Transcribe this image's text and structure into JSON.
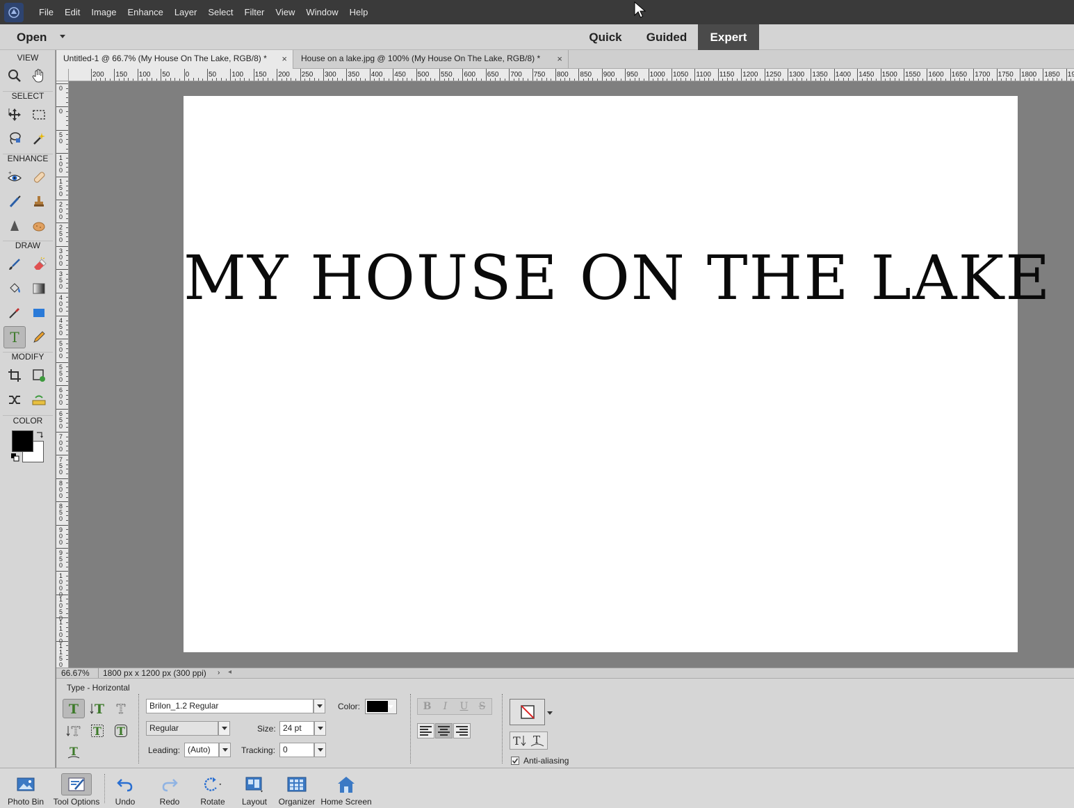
{
  "menubar": {
    "logo_icon": "elements-logo-icon",
    "items": [
      "File",
      "Edit",
      "Image",
      "Enhance",
      "Layer",
      "Select",
      "Filter",
      "View",
      "Window",
      "Help"
    ]
  },
  "modebar": {
    "open_label": "Open",
    "tabs": {
      "quick": "Quick",
      "guided": "Guided",
      "expert": "Expert"
    },
    "active_tab": "Expert"
  },
  "toolbox": {
    "sections": {
      "view": "VIEW",
      "select": "SELECT",
      "enhance": "ENHANCE",
      "draw": "DRAW",
      "modify": "MODIFY",
      "color": "COLOR"
    },
    "tools": {
      "view": [
        "zoom-tool-icon",
        "hand-tool-icon"
      ],
      "select": [
        "move-tool-icon",
        "marquee-tool-icon",
        "lasso-tool-icon",
        "magic-wand-icon"
      ],
      "enhance": [
        "red-eye-icon",
        "spot-healing-icon",
        "smart-brush-icon",
        "clone-stamp-icon",
        "blur-icon",
        "sponge-icon"
      ],
      "draw": [
        "brush-icon",
        "eraser-icon",
        "paint-bucket-icon",
        "gradient-icon",
        "eyedropper-icon",
        "rectangle-shape-icon",
        "type-tool-icon",
        "pencil-icon"
      ],
      "modify": [
        "crop-icon",
        "recompose-icon",
        "content-aware-move-icon",
        "straighten-icon"
      ]
    },
    "active_tool": "type-tool-icon",
    "foreground_color": "#000000",
    "background_color": "#ffffff"
  },
  "documents": {
    "tabs": [
      {
        "label": "Untitled-1 @ 66.7% (My House On The Lake, RGB/8) *",
        "close": "×",
        "active": true
      },
      {
        "label": "House on a lake.jpg @ 100% (My House On The Lake, RGB/8) *",
        "close": "×",
        "active": false
      }
    ]
  },
  "rulers": {
    "horizontal": [
      "200",
      "150",
      "100",
      "50",
      "0",
      "50",
      "100",
      "150",
      "200",
      "250",
      "300",
      "350",
      "400",
      "450",
      "500",
      "550",
      "600",
      "650",
      "700",
      "750",
      "800",
      "850",
      "900",
      "950",
      "1000",
      "1050",
      "1100",
      "1150",
      "1200",
      "1250",
      "1300",
      "1350",
      "1400",
      "1450",
      "1500",
      "1550",
      "1600",
      "1650",
      "1700",
      "1750",
      "1800",
      "1850",
      "19"
    ],
    "vertical": [
      "0",
      "0",
      "50",
      "100",
      "150",
      "200",
      "250",
      "300",
      "350",
      "400",
      "450",
      "500",
      "550",
      "600",
      "650",
      "700",
      "750",
      "800",
      "850",
      "900",
      "950",
      "1000",
      "1050",
      "1100",
      "1150"
    ]
  },
  "canvas": {
    "text": "MY HOUSE ON THE LAKE"
  },
  "status": {
    "zoom": "66.67%",
    "doc_info": "1800 px x 1200 px (300 ppi)"
  },
  "options": {
    "title": "Type - Horizontal",
    "font_family": "Brilon_1.2 Regular",
    "font_style": "Regular",
    "color_label": "Color:",
    "size_label": "Size:",
    "size_value": "24 pt",
    "leading_label": "Leading:",
    "leading_value": "(Auto)",
    "tracking_label": "Tracking:",
    "tracking_value": "0",
    "text_color": "#000000",
    "format_buttons": [
      "B",
      "I",
      "U",
      "S"
    ],
    "alignment": "center",
    "anti_aliasing_label": "Anti-aliasing",
    "anti_aliasing_checked": true
  },
  "bottombar": {
    "buttons": [
      {
        "label": "Photo Bin",
        "icon": "photo-bin-icon"
      },
      {
        "label": "Tool Options",
        "icon": "tool-options-icon"
      },
      {
        "label": "Undo",
        "icon": "undo-icon"
      },
      {
        "label": "Redo",
        "icon": "redo-icon"
      },
      {
        "label": "Rotate",
        "icon": "rotate-icon"
      },
      {
        "label": "Layout",
        "icon": "layout-icon"
      },
      {
        "label": "Organizer",
        "icon": "organizer-icon"
      },
      {
        "label": "Home Screen",
        "icon": "home-screen-icon"
      }
    ],
    "active": "Tool Options"
  }
}
